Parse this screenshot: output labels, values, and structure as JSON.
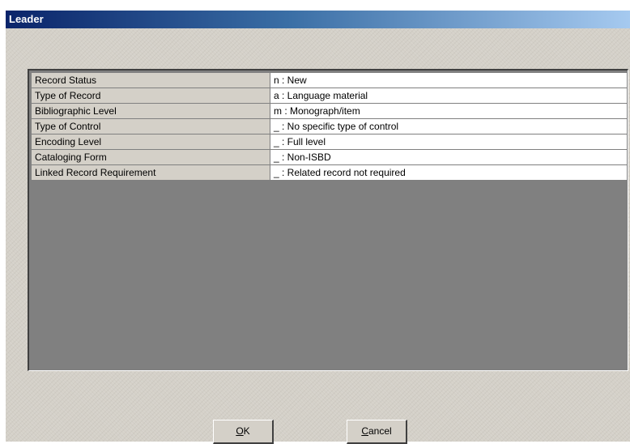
{
  "window": {
    "title": "Leader"
  },
  "leader_fields": [
    {
      "label": "Record Status",
      "value": "n : New"
    },
    {
      "label": "Type of Record",
      "value": "a : Language material"
    },
    {
      "label": "Bibliographic Level",
      "value": "m : Monograph/item"
    },
    {
      "label": "Type of Control",
      "value": "_ : No specific type of control"
    },
    {
      "label": "Encoding Level",
      "value": "_ : Full level"
    },
    {
      "label": "Cataloging Form",
      "value": "_ : Non-ISBD"
    },
    {
      "label": "Linked Record Requirement",
      "value": "_ : Related record not required"
    }
  ],
  "buttons": {
    "ok": {
      "mnemonic": "O",
      "rest": "K"
    },
    "cancel": {
      "mnemonic": "C",
      "rest": "ancel"
    }
  },
  "colors": {
    "title_start": "#0a246a",
    "title_end": "#a6caf0",
    "dialog_bg": "#d4d0c8",
    "grid_empty": "#808080"
  }
}
